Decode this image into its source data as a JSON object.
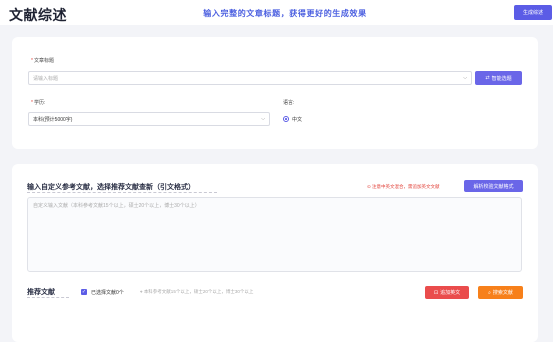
{
  "header": {
    "title": "文献综述",
    "tagline": "输入完整的文章标题，获得更好的生成效果",
    "generate_button": "生成综述"
  },
  "form": {
    "title_label": "文章标题",
    "title_placeholder": "请输入标题",
    "smart_button": "智能选题",
    "degree_label": "学历:",
    "degree_value": "本科(预计5000字)",
    "language_label": "语言:",
    "language_value": "中文"
  },
  "references": {
    "section_title": "输入自定义参考文献，选择推荐文献查新（引文格式）",
    "warning": "注意中英文混合，需追加英文文献",
    "parse_button": "解析校验文献格式",
    "textarea_placeholder": "自定义输入文献（本科参考文献15个以上，硕士20个以上，博士30个以上）"
  },
  "recommend": {
    "section_title": "推荐文献",
    "selected_label": "已选择文献0个",
    "hint": "本科参考文献15个以上，硕士20个以上，博士30个以上",
    "add_english_button": "追加英文",
    "search_button": "搜索文献"
  }
}
